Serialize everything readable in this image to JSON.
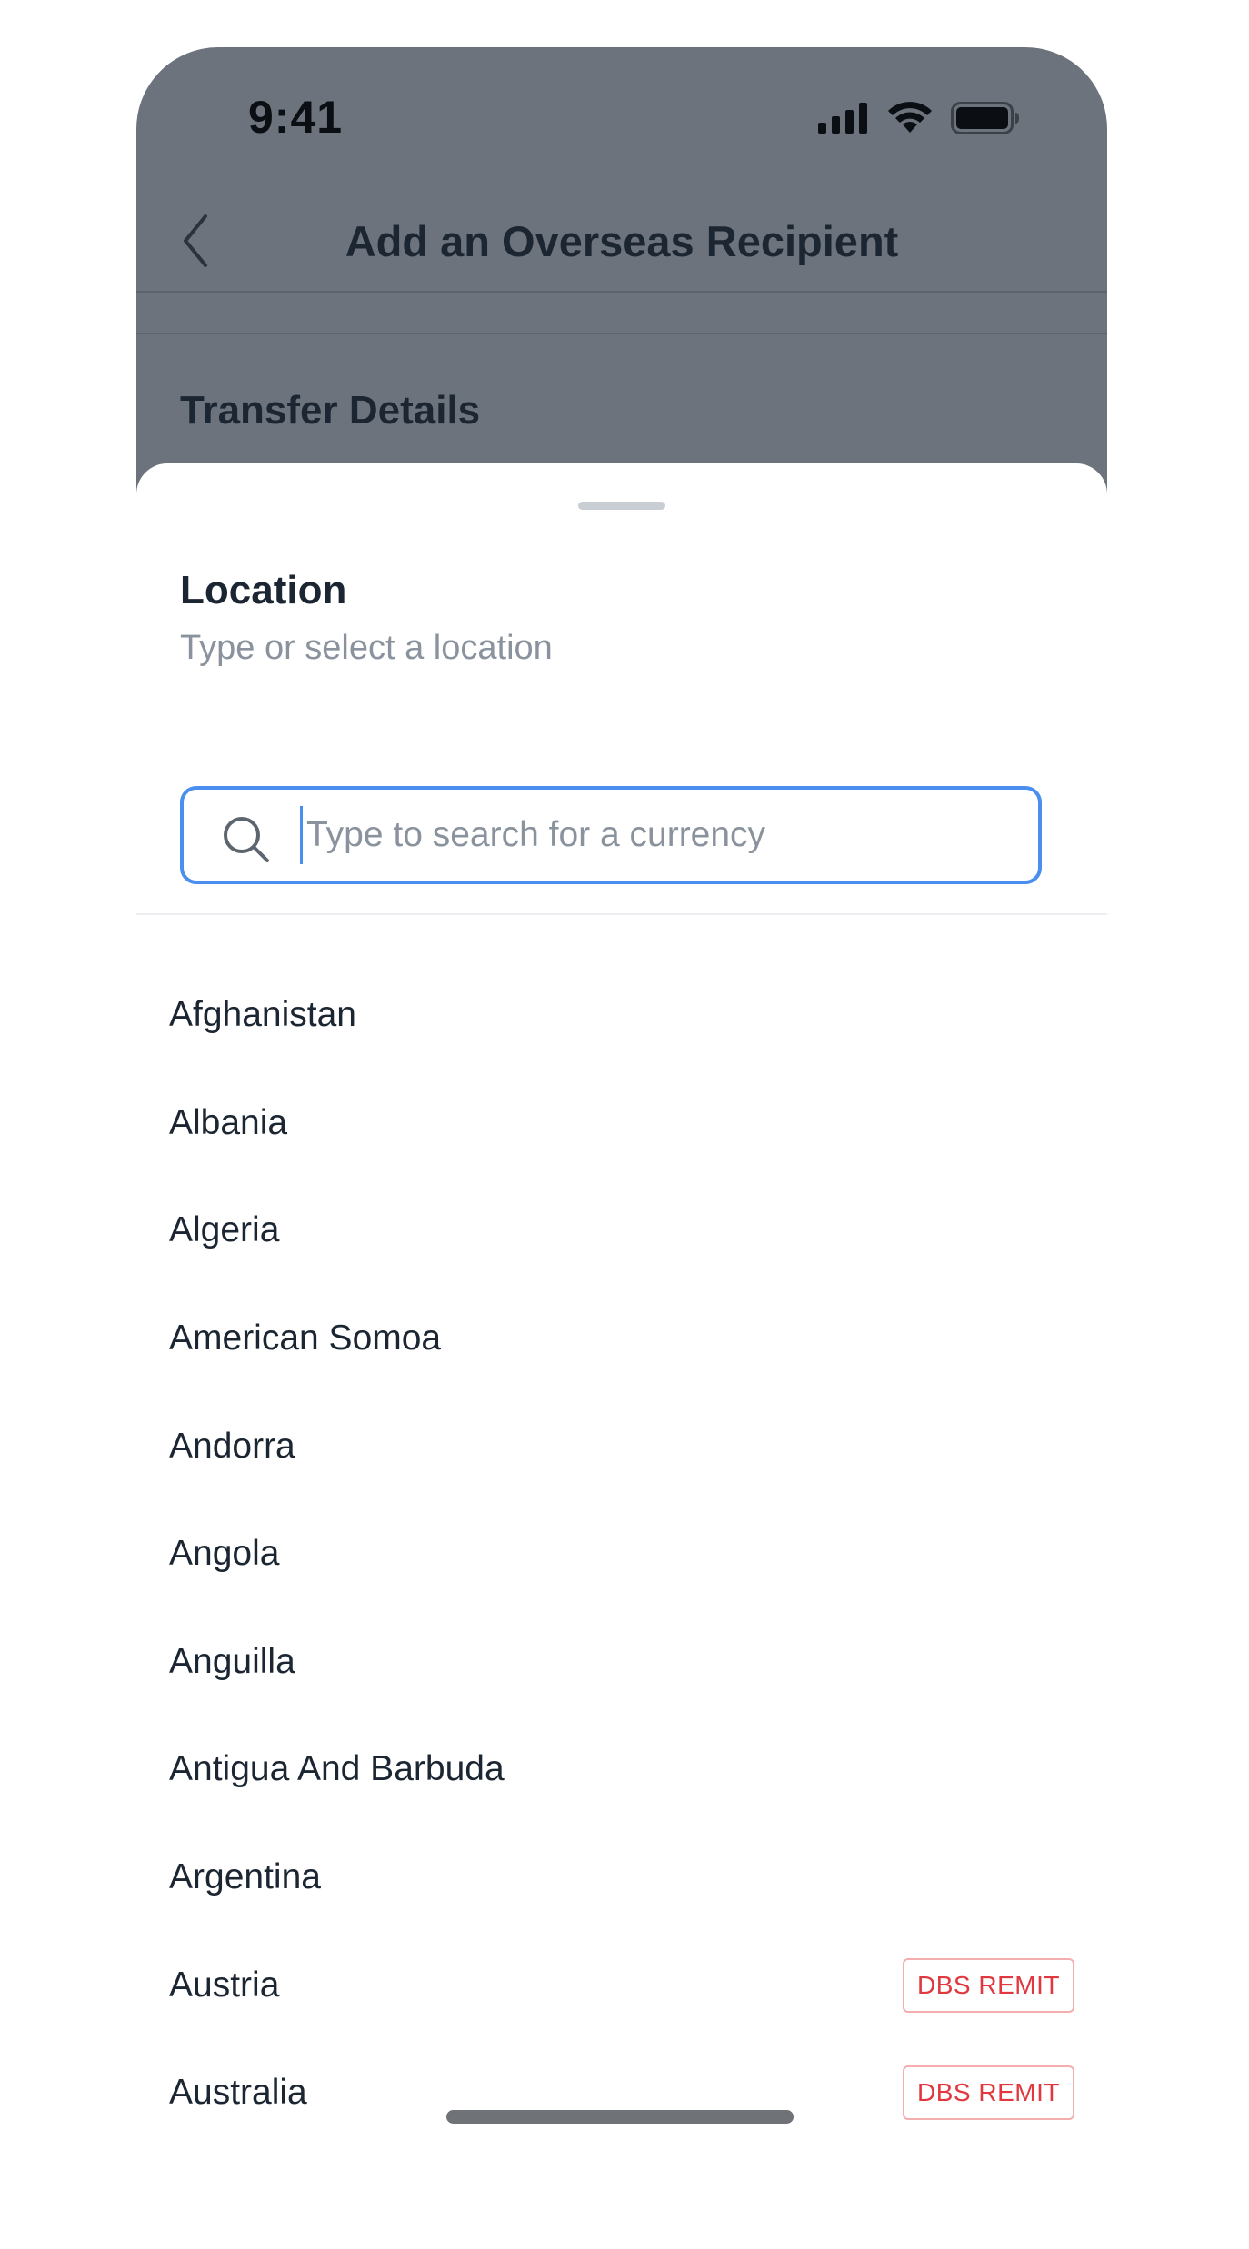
{
  "status_bar": {
    "time": "9:41",
    "icons": [
      "signal-icon",
      "wifi-icon",
      "battery-icon"
    ]
  },
  "nav": {
    "back_icon": "chevron-left-icon",
    "title": "Add an Overseas Recipient"
  },
  "background": {
    "section_title": "Transfer Details"
  },
  "sheet": {
    "title": "Location",
    "subtitle": "Type or select a location",
    "search": {
      "placeholder": "Type to search for a currency",
      "value": ""
    },
    "countries": [
      {
        "name": "Afghanistan",
        "badge": ""
      },
      {
        "name": "Albania",
        "badge": ""
      },
      {
        "name": "Algeria",
        "badge": ""
      },
      {
        "name": "American Somoa",
        "badge": ""
      },
      {
        "name": "Andorra",
        "badge": ""
      },
      {
        "name": "Angola",
        "badge": ""
      },
      {
        "name": "Anguilla",
        "badge": ""
      },
      {
        "name": "Antigua And Barbuda",
        "badge": ""
      },
      {
        "name": "Argentina",
        "badge": ""
      },
      {
        "name": "Austria",
        "badge": "DBS REMIT"
      },
      {
        "name": "Australia",
        "badge": "DBS REMIT"
      }
    ]
  },
  "colors": {
    "overlay": "#6c737c",
    "accent": "#4a8ef0",
    "badge_red": "#e0383e",
    "text_primary": "#1b2632",
    "text_secondary": "#8a939d"
  }
}
